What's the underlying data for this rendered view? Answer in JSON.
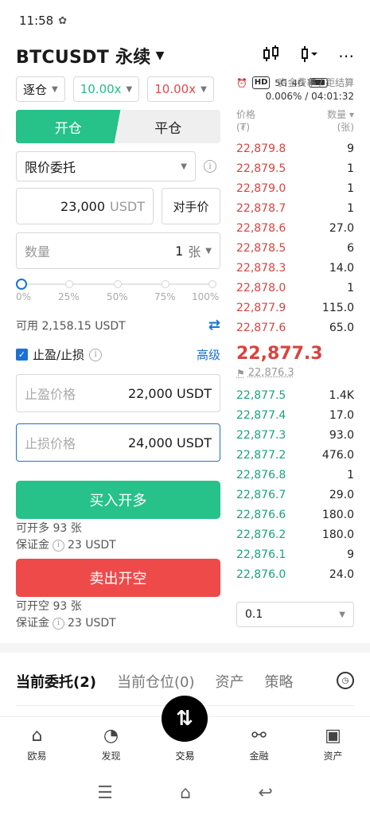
{
  "status": {
    "time": "11:58",
    "network_1": "5G",
    "network_2": "4G",
    "hd": "HD"
  },
  "header": {
    "title": "BTCUSDT 永续"
  },
  "leverage": {
    "mode": "逐仓",
    "long": "10.00x",
    "short": "10.00x"
  },
  "tabs": {
    "open": "开仓",
    "close": "平仓"
  },
  "order_type": "限价委托",
  "price_input": {
    "value": "23,000",
    "unit": "USDT"
  },
  "counter_price_button": "对手价",
  "quantity": {
    "placeholder": "数量",
    "value": "1",
    "unit": "张"
  },
  "slider": {
    "labels": [
      "0%",
      "25%",
      "50%",
      "75%",
      "100%"
    ],
    "value_percent": 0
  },
  "available": "可用 2,158.15 USDT",
  "tpsl": {
    "label": "止盈/止损",
    "checked": true,
    "advanced": "高级"
  },
  "take_profit": {
    "placeholder": "止盈价格",
    "value": "22,000 USDT"
  },
  "stop_loss": {
    "placeholder": "止损价格",
    "value": "24,000 USDT"
  },
  "buy": {
    "label": "买入开多",
    "can_open": "可开多 93 张",
    "margin": "保证金",
    "margin_value": "23 USDT"
  },
  "sell": {
    "label": "卖出开空",
    "can_open": "可开空 93 张",
    "margin": "保证金",
    "margin_value": "23 USDT"
  },
  "funding": {
    "label": "资金费率 / 距结算",
    "value": "0.006% / 04:01:32"
  },
  "orderbook": {
    "price_header": "价格",
    "price_unit": "(₮)",
    "qty_header": "数量",
    "qty_unit": "(张)",
    "asks": [
      {
        "price": "22,879.8",
        "qty": "9"
      },
      {
        "price": "22,879.5",
        "qty": "1"
      },
      {
        "price": "22,879.0",
        "qty": "1"
      },
      {
        "price": "22,878.7",
        "qty": "1"
      },
      {
        "price": "22,878.6",
        "qty": "27.0"
      },
      {
        "price": "22,878.5",
        "qty": "6"
      },
      {
        "price": "22,878.3",
        "qty": "14.0"
      },
      {
        "price": "22,878.0",
        "qty": "1"
      },
      {
        "price": "22,877.9",
        "qty": "115.0"
      },
      {
        "price": "22,877.6",
        "qty": "65.0"
      }
    ],
    "last_price": "22,877.3",
    "mark_price": "22,876.3",
    "bids": [
      {
        "price": "22,877.5",
        "qty": "1.4K"
      },
      {
        "price": "22,877.4",
        "qty": "17.0"
      },
      {
        "price": "22,877.3",
        "qty": "93.0"
      },
      {
        "price": "22,877.2",
        "qty": "476.0"
      },
      {
        "price": "22,876.8",
        "qty": "1"
      },
      {
        "price": "22,876.7",
        "qty": "29.0"
      },
      {
        "price": "22,876.6",
        "qty": "180.0"
      },
      {
        "price": "22,876.2",
        "qty": "180.0"
      },
      {
        "price": "22,876.1",
        "qty": "9"
      },
      {
        "price": "22,876.0",
        "qty": "24.0"
      }
    ],
    "depth": "0.1"
  },
  "order_tabs": [
    "当前委托(2)",
    "当前仓位(0)",
    "资产",
    "策略"
  ],
  "nav": [
    "欧易",
    "发现",
    "交易",
    "金融",
    "资产"
  ],
  "colors": {
    "green": "#27c18a",
    "red": "#ef4a4a",
    "blue": "#1a73d4"
  }
}
